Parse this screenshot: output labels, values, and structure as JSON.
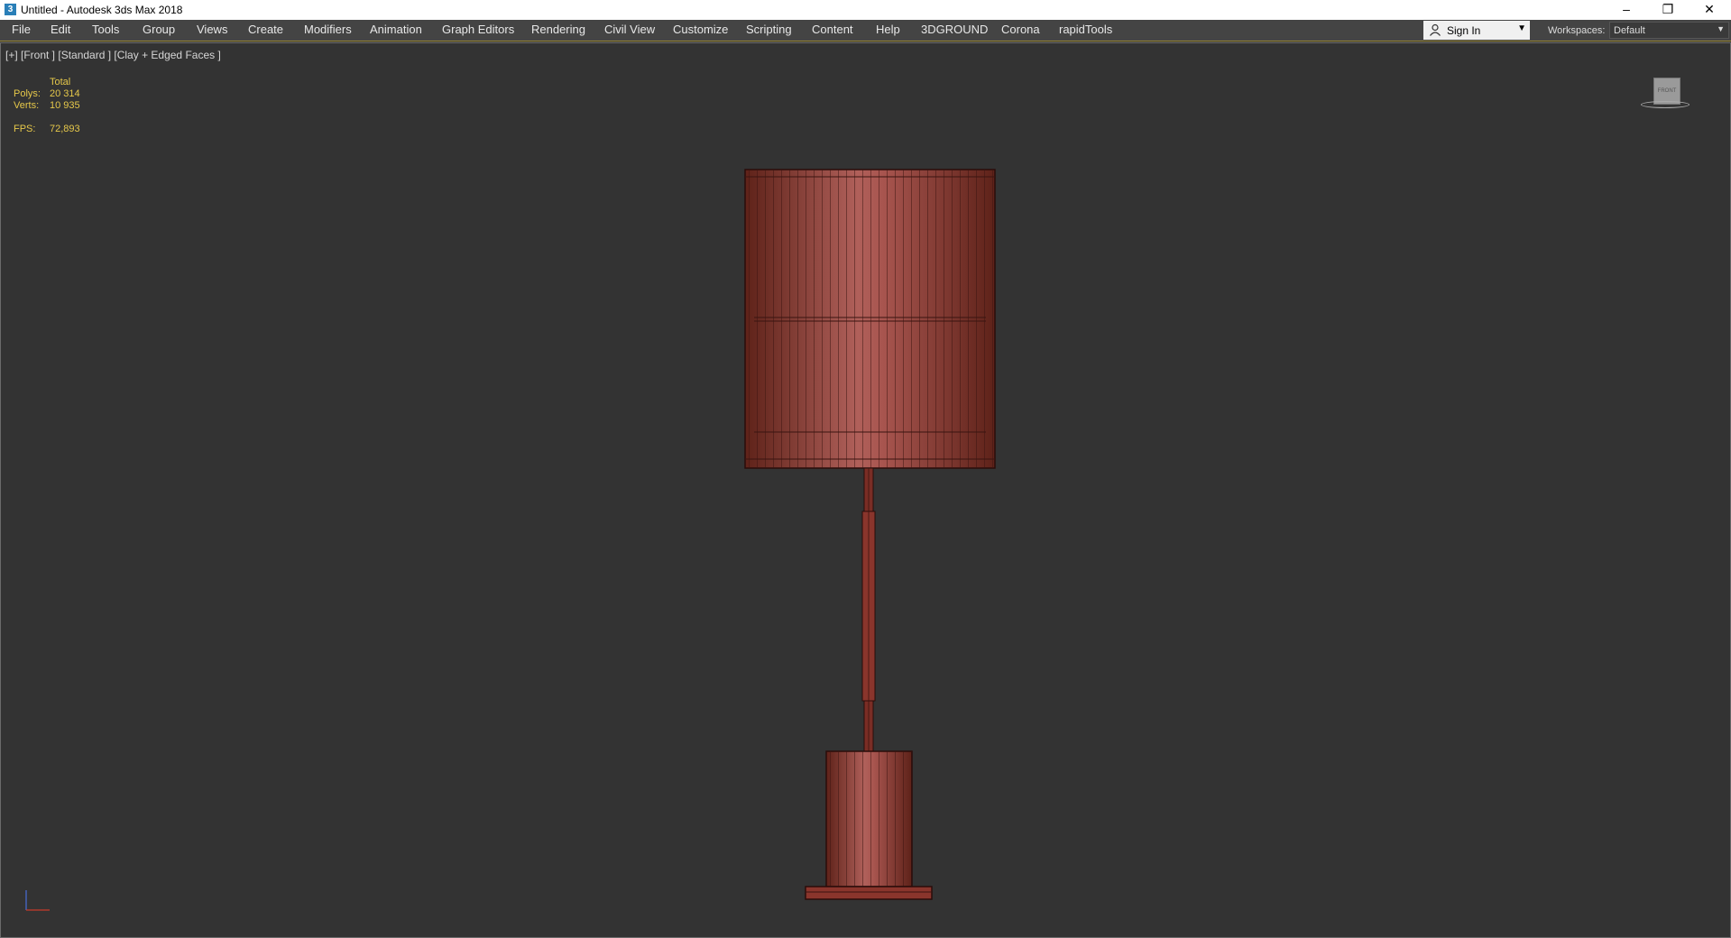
{
  "window": {
    "title": "Untitled - Autodesk 3ds Max 2018",
    "controls": {
      "minimize": "–",
      "restore": "❐",
      "close": "✕"
    }
  },
  "menu": {
    "items": [
      "File",
      "Edit",
      "Tools",
      "Group",
      "Views",
      "Create",
      "Modifiers",
      "Animation",
      "Graph Editors",
      "Rendering",
      "Civil View",
      "Customize",
      "Scripting",
      "Content",
      "Help",
      "3DGROUND",
      "Corona",
      "rapidTools"
    ],
    "sign_in": "Sign In",
    "workspaces_label": "Workspaces:",
    "workspace_value": "Default"
  },
  "viewport": {
    "label": "[+] [Front ] [Standard ] [Clay + Edged Faces ]",
    "stats": {
      "header": "Total",
      "polys_label": "Polys:",
      "polys_value": "20 314",
      "verts_label": "Verts:",
      "verts_value": "10 935",
      "fps_label": "FPS:",
      "fps_value": "72,893"
    },
    "viewcube_label": "FRONT"
  },
  "colors": {
    "accent": "#e6c84a",
    "model": "#8c3a32",
    "viewport_bg": "#333333",
    "menubar_bg": "#444444"
  }
}
